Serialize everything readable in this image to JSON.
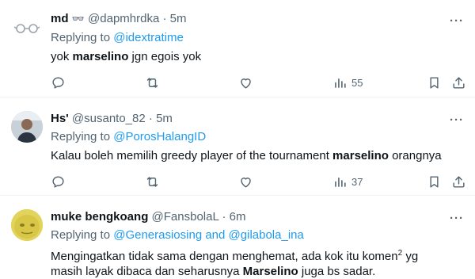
{
  "tweets": [
    {
      "name": "md",
      "name_emoji": "👓",
      "handle": "@dapmhrdka",
      "dot": "·",
      "time": "5m",
      "replying_prefix": "Replying to",
      "replying_to": [
        "@idextratime"
      ],
      "replying_joiner": "",
      "text_before": "yok ",
      "text_bold": "marselino",
      "text_after": " jgn egois yok",
      "views": "55"
    },
    {
      "name": "Hs'",
      "handle": "@susanto_82",
      "dot": "·",
      "time": "5m",
      "replying_prefix": "Replying to",
      "replying_to": [
        "@PorosHalangID"
      ],
      "replying_joiner": "",
      "text_before": "Kalau boleh memilih greedy player of the tournament ",
      "text_bold": "marselino",
      "text_after": " orangnya",
      "views": "37"
    },
    {
      "name": "muke bengkoang",
      "handle": "@FansbolaL",
      "dot": "·",
      "time": "6m",
      "replying_prefix": "Replying to",
      "replying_to": [
        "@Generasiosing",
        "@gilabola_ina"
      ],
      "replying_joiner": "and",
      "text_line1": "Mengingatkan tidak sama dengan menghemat, ada kok itu komen",
      "text_sup": "2",
      "text_line1_end": " yg",
      "text_line2_before": "masih layak dibaca dan seharusnya ",
      "text_bold": "Marselino",
      "text_line2_after": " juga bs sadar."
    }
  ],
  "more_glyph": "···",
  "colors": {
    "link": "#1d9bf0",
    "muted": "#536471",
    "text": "#0f1419",
    "divider": "#eff3f4"
  }
}
